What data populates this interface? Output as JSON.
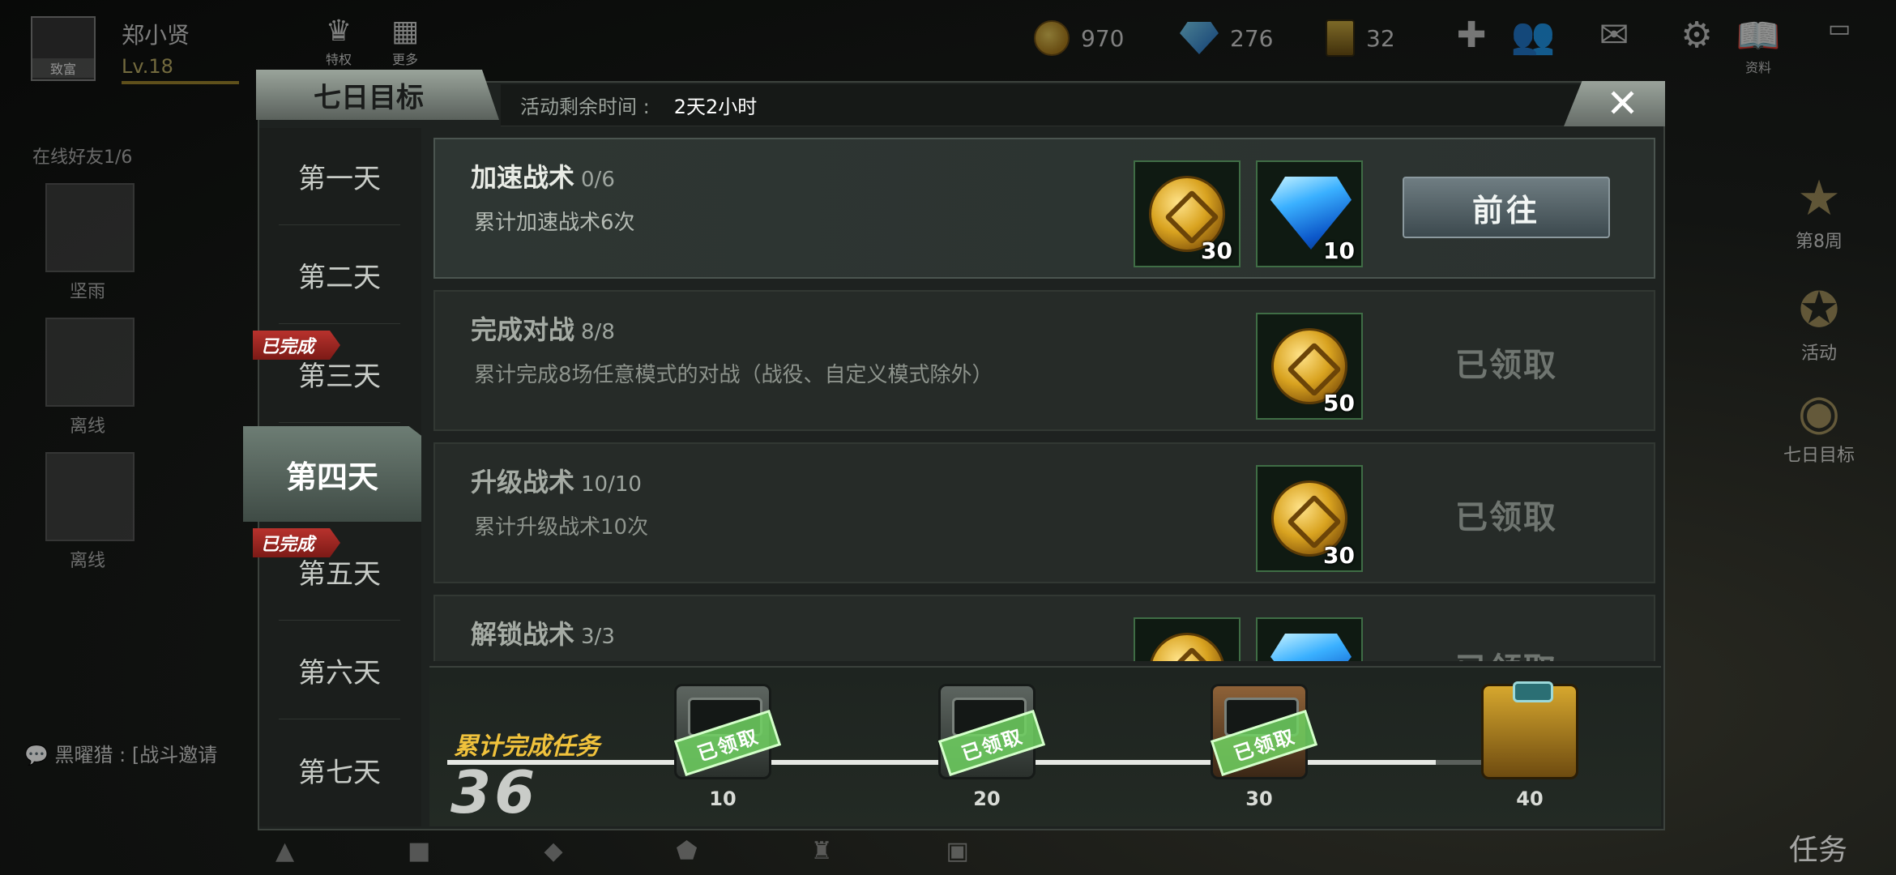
{
  "topbar": {
    "player_name": "郑小贤",
    "player_level": "Lv.18",
    "avatar_tag": "致富",
    "privilege_label": "特权",
    "more_label": "更多",
    "gold": "970",
    "diamonds": "276",
    "cards": "32",
    "profile_label": "资料"
  },
  "left_bg": {
    "friends_online": "在线好友1/6",
    "friend_name": "坚雨",
    "status_offline_1": "离线",
    "status_offline_2": "离线"
  },
  "chat": {
    "line": "黑曜猎 : [战斗邀请"
  },
  "right_bg": {
    "week_label": "第8周",
    "activity_label": "活动",
    "seven_day_label": "七日目标",
    "task_label": "任务"
  },
  "dialog": {
    "title": "七日目标",
    "remaining_label": "活动剩余时间 :",
    "remaining_value": "2天2小时",
    "close_symbol": "✕"
  },
  "days": [
    {
      "label": "第一天",
      "completed": false,
      "active": false
    },
    {
      "label": "第二天",
      "completed": false,
      "active": false
    },
    {
      "label": "第三天",
      "completed": true,
      "active": false
    },
    {
      "label": "第四天",
      "completed": false,
      "active": true
    },
    {
      "label": "第五天",
      "completed": true,
      "active": false
    },
    {
      "label": "第六天",
      "completed": false,
      "active": false
    },
    {
      "label": "第七天",
      "completed": false,
      "active": false
    }
  ],
  "completed_badge": "已完成",
  "tasks": [
    {
      "name": "加速战术",
      "progress": "0/6",
      "desc": "累计加速战术6次",
      "rewards": [
        {
          "icon": "gold-coin-icon",
          "qty": "30"
        },
        {
          "icon": "diamond-icon",
          "qty": "10"
        }
      ],
      "action": "前往"
    },
    {
      "name": "完成对战",
      "progress": "8/8",
      "desc": "累计完成8场任意模式的对战（战役、自定义模式除外）",
      "rewards": [
        {
          "icon": "gold-coin-icon",
          "qty": "50"
        }
      ],
      "status": "已领取"
    },
    {
      "name": "升级战术",
      "progress": "10/10",
      "desc": "累计升级战术10次",
      "rewards": [
        {
          "icon": "gold-coin-icon",
          "qty": "30"
        }
      ],
      "status": "已领取"
    },
    {
      "name": "解锁战术",
      "progress": "3/3",
      "desc": "",
      "rewards": [
        {
          "icon": "gold-coin-icon",
          "qty": ""
        },
        {
          "icon": "diamond-icon",
          "qty": ""
        }
      ],
      "status": "已领取"
    }
  ],
  "footer": {
    "label": "累计完成任务",
    "count": "36",
    "claimed_stamp": "已领取",
    "milestones": [
      "10",
      "20",
      "30",
      "40"
    ]
  }
}
